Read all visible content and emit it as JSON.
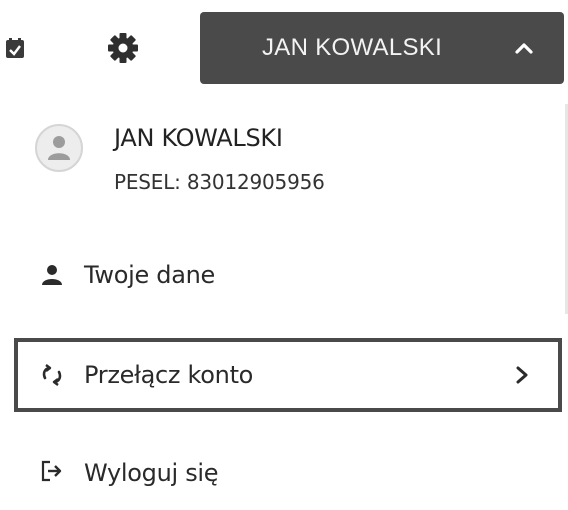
{
  "header": {
    "user_button_label": "JAN KOWALSKI",
    "icons": [
      "calendar-icon",
      "gear-icon",
      "chevron-up-icon"
    ]
  },
  "profile": {
    "name": "JAN KOWALSKI",
    "pesel": "PESEL: 83012905956",
    "icon": "avatar-user-icon"
  },
  "menu": {
    "items": [
      {
        "label": "Twoje dane",
        "icon": "user-icon"
      },
      {
        "label": "Przełącz konto",
        "icon": "switch-account-icon",
        "selected": true,
        "trailing_icon": "chevron-right-icon"
      },
      {
        "label": "Wyloguj się",
        "icon": "logout-icon"
      }
    ]
  },
  "colors": {
    "header_button_bg": "#4a4a4a",
    "header_button_text": "#f3f3f3",
    "focus_border": "#4a4a4a",
    "text": "#2a2a2a"
  }
}
